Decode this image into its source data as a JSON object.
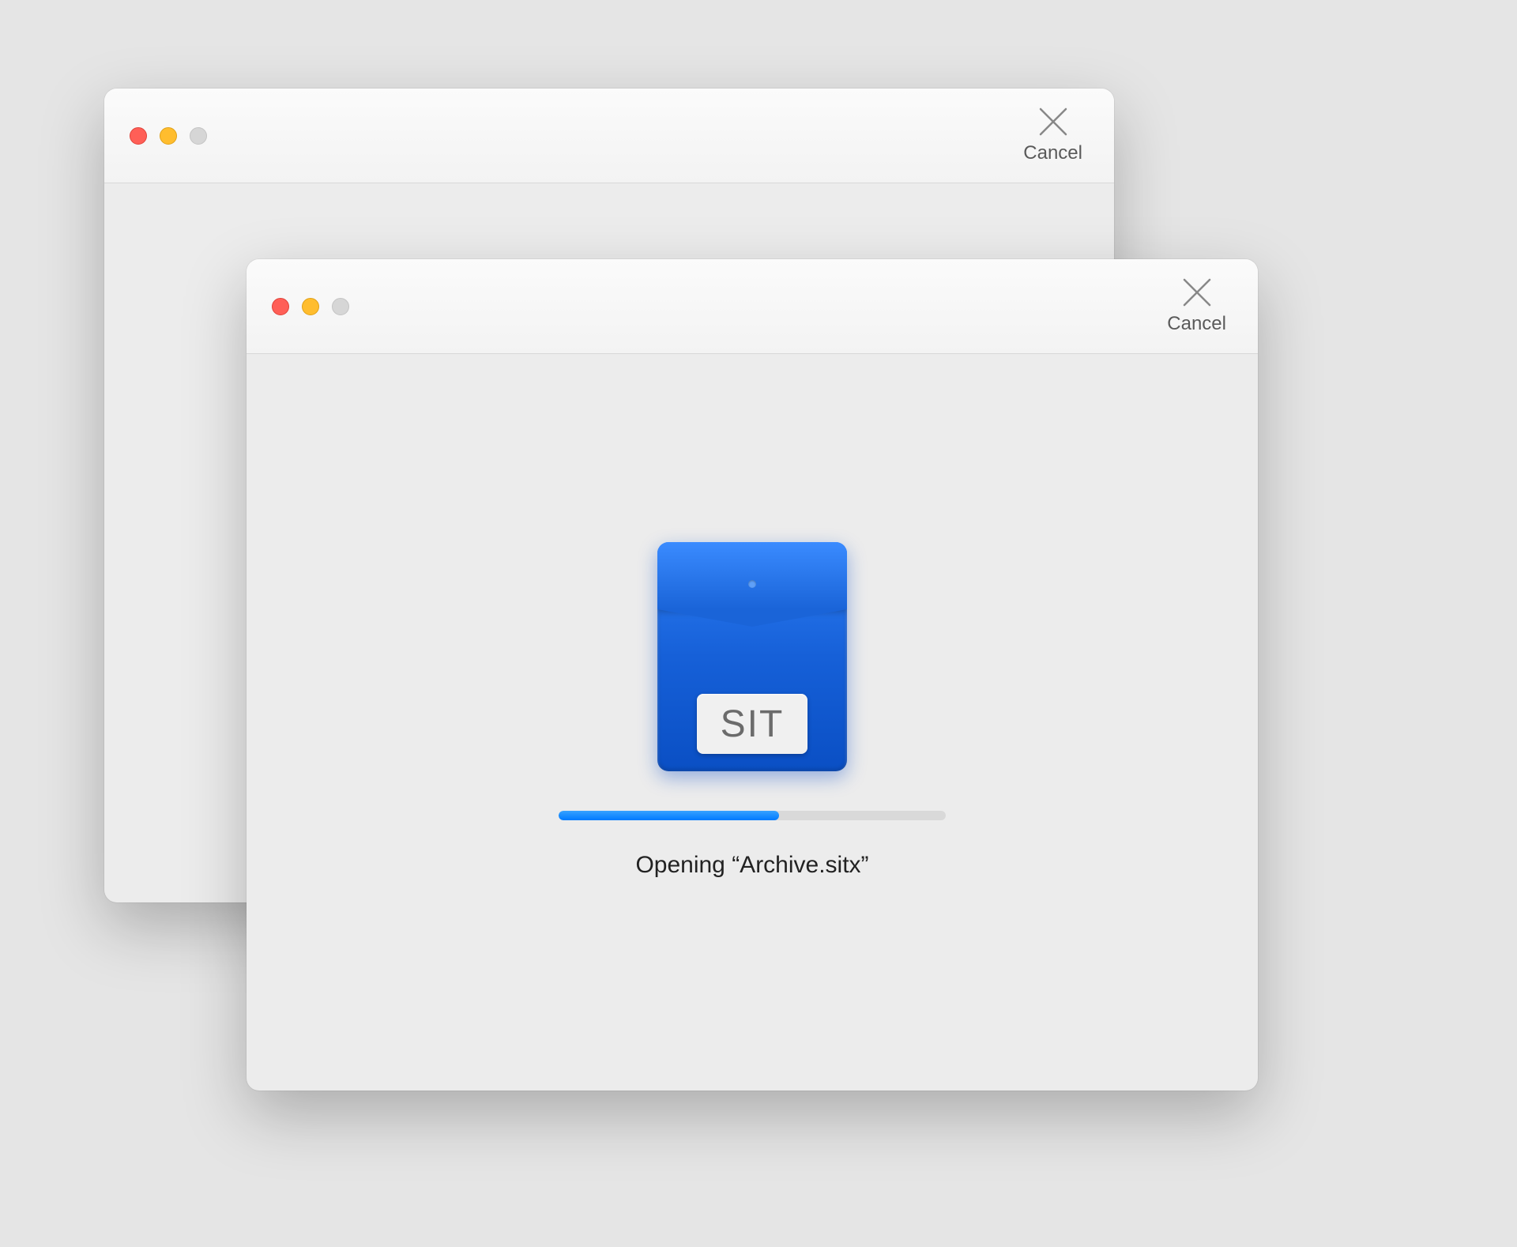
{
  "windows": {
    "back": {
      "cancel_label": "Cancel"
    },
    "front": {
      "cancel_label": "Cancel",
      "archive_badge_text": "SIT",
      "progress_percent": 57,
      "status_text": "Opening “Archive.sitx”"
    }
  },
  "colors": {
    "accent": "#007aff",
    "background": "#ececec"
  }
}
